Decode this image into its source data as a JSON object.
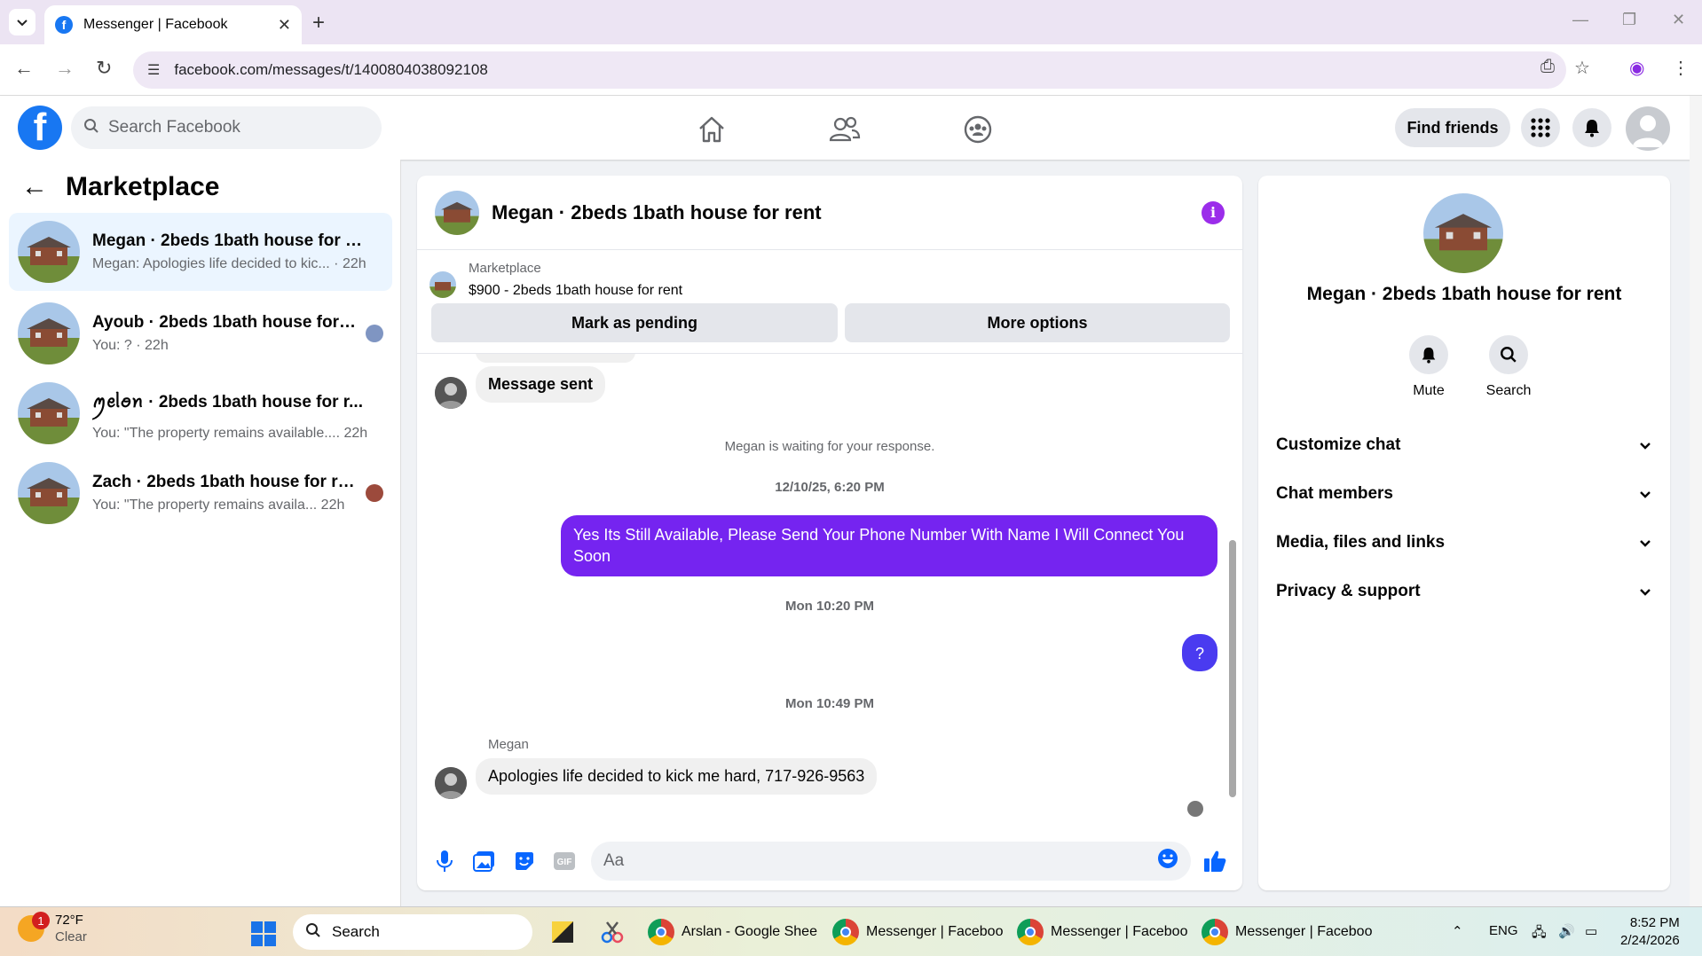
{
  "browser": {
    "tab_title": "Messenger | Facebook",
    "url": "facebook.com/messages/t/1400804038092108"
  },
  "fb": {
    "search_placeholder": "Search Facebook",
    "find_friends": "Find friends"
  },
  "left": {
    "title": "Marketplace",
    "conversations": [
      {
        "name": "Megan · 2beds 1bath house for rent",
        "preview": "Megan: Apologies life decided to kic...",
        "time": "· 22h"
      },
      {
        "name": "Ayoub · 2beds 1bath house for r...",
        "preview": "You: ?",
        "time": "· 22h"
      },
      {
        "name": "ꪑꫀᥣꪮꪀ · 2beds 1bath house for r...",
        "preview": "You: \"The property remains available....",
        "time": "22h"
      },
      {
        "name": "Zach · 2beds 1bath house for rent",
        "preview": "You: \"The property remains availa...",
        "time": "22h"
      }
    ]
  },
  "chat": {
    "title": "Megan · 2beds 1bath house for rent",
    "banner_label": "Marketplace",
    "banner_listing": "$900 - 2beds 1bath house for rent",
    "btn_pending": "Mark as pending",
    "btn_more": "More options",
    "msg_sent": "Message sent",
    "waiting": "Megan is waiting for your response.",
    "stamp1": "12/10/25, 6:20 PM",
    "out1": "Yes Its Still Available, Please Send Your Phone Number With Name I Will Connect You Soon",
    "stamp2": "Mon 10:20 PM",
    "out2": "?",
    "stamp3": "Mon 10:49 PM",
    "sender": "Megan",
    "in_last": "Apologies life decided to kick me hard, 717-926-9563",
    "input_placeholder": "Aa"
  },
  "info": {
    "name": "Megan · 2beds 1bath house for rent",
    "mute": "Mute",
    "search": "Search",
    "rows": [
      "Customize chat",
      "Chat members",
      "Media, files and links",
      "Privacy & support"
    ]
  },
  "taskbar": {
    "temp": "72°F",
    "cond": "Clear",
    "weather_badge": "1",
    "search": "Search",
    "apps": [
      "Arslan - Google Shee",
      "Messenger | Faceboo",
      "Messenger | Faceboo",
      "Messenger | Faceboo"
    ],
    "lang": "ENG",
    "time": "8:52 PM",
    "date": "2/24/2026"
  },
  "colors": {
    "fb_blue": "#1877f2",
    "outgoing_bubble": "#7524f0",
    "info_icon": "#9b2dea"
  }
}
